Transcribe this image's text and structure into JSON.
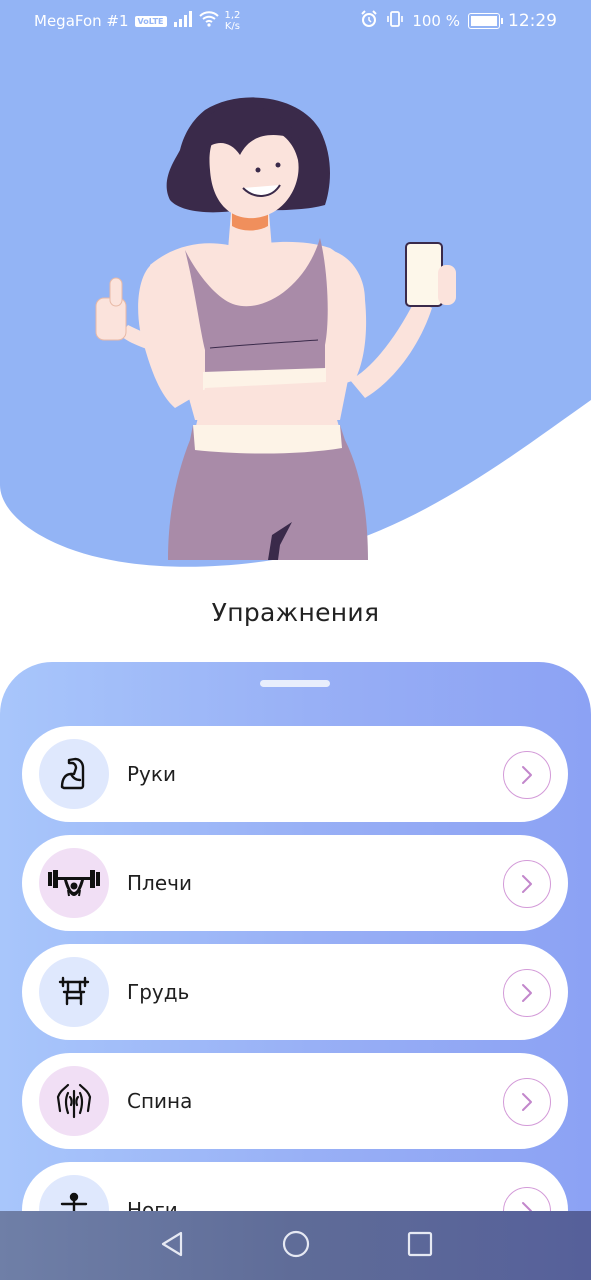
{
  "status_bar": {
    "carrier": "MegaFon #1",
    "volte": "VoLTE",
    "net_speed_value": "1,2",
    "net_speed_unit": "K/s",
    "battery": "100 %",
    "battery_level": 1.0,
    "time": "12:29"
  },
  "page": {
    "title": "Упражнения"
  },
  "categories": [
    {
      "label": "Руки",
      "icon": "flexed-arm-icon",
      "icon_bg": "#dfe8fd"
    },
    {
      "label": "Плечи",
      "icon": "barbell-shoulders-icon",
      "icon_bg": "#f1dff5"
    },
    {
      "label": "Грудь",
      "icon": "bench-press-icon",
      "icon_bg": "#dfe8fd"
    },
    {
      "label": "Спина",
      "icon": "back-muscles-icon",
      "icon_bg": "#f1dff5"
    },
    {
      "label": "Ноги",
      "icon": "legs-figure-icon",
      "icon_bg": "#dfe8fd"
    }
  ],
  "colors": {
    "hero_bg": "#93b4f5",
    "sheet_gradient_start": "#a8c6fb",
    "sheet_gradient_end": "#8ca2f4",
    "arrow_accent": "#d39ad8",
    "nav_bar": "#5f6c98"
  },
  "nav_bar": {
    "back_icon": "triangle-back-icon",
    "home_icon": "circle-home-icon",
    "recents_icon": "square-recents-icon"
  }
}
